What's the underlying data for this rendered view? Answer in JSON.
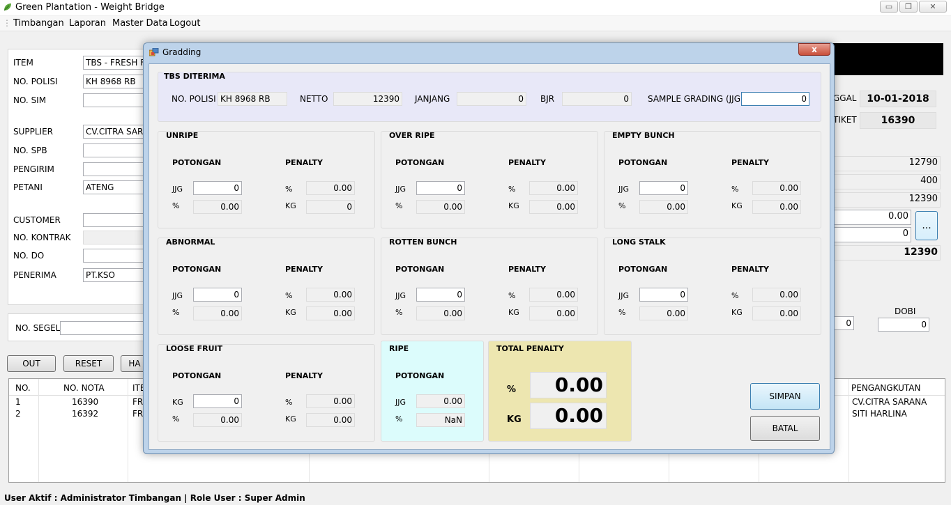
{
  "app": {
    "title": "Green Plantation - Weight Bridge",
    "window_controls": {
      "minimize": "▭",
      "maximize": "❐",
      "close": "✕"
    }
  },
  "menu": [
    "Timbangan",
    "Laporan",
    "Master Data",
    "Logout"
  ],
  "form": {
    "item_label": "ITEM",
    "item_value": "TBS - FRESH FR",
    "no_polisi_label": "NO. POLISI",
    "no_polisi_value": "KH 8968 RB",
    "no_sim_label": "NO. SIM",
    "no_sim_value": "",
    "supplier_label": "SUPPLIER",
    "supplier_value": "CV.CITRA SARA",
    "no_spb_label": "NO. SPB",
    "no_spb_value": "",
    "pengirim_label": "PENGIRIM",
    "pengirim_value": "",
    "petani_label": "PETANI",
    "petani_value": "ATENG",
    "customer_label": "CUSTOMER",
    "customer_value": "",
    "no_kontrak_label": "NO. KONTRAK",
    "no_kontrak_value": "",
    "no_do_label": "NO. DO",
    "no_do_value": "",
    "penerima_label": "PENERIMA",
    "penerima_value": "PT.KSO",
    "no_segel_label": "NO. SEGEL",
    "no_segel_value": ""
  },
  "right_panel": {
    "tanggal_label": "GGAL",
    "tanggal_value": "10-01-2018",
    "tiket_label": "TIKET",
    "tiket_value": "16390",
    "w1": "12790",
    "w2": "400",
    "w3": "12390",
    "w4": "0.00",
    "w5": "0",
    "ellipsis": "...",
    "w6": "12390",
    "dobi_label": "DOBI",
    "dobi_value": "0",
    "left_small": "0"
  },
  "actions": {
    "out": "OUT",
    "reset": "RESET",
    "ha": "HA"
  },
  "grid": {
    "columns": [
      "NO.",
      "NO. NOTA",
      "ITE",
      "PENGANGKUTAN"
    ],
    "rows": [
      {
        "no": "1",
        "nota": "16390",
        "item": "FR",
        "pengangkutan": "CV.CITRA SARANA"
      },
      {
        "no": "2",
        "nota": "16392",
        "item": "FR",
        "pengangkutan": "SITI HARLINA"
      }
    ]
  },
  "status": {
    "text": "User Aktif : Administrator Timbangan  |  Role User : Super Admin"
  },
  "dialog": {
    "title": "Gradding",
    "close": "x",
    "tbs": {
      "title": "TBS DITERIMA",
      "no_polisi_label": "NO. POLISI",
      "no_polisi_value": "KH 8968 RB",
      "netto_label": "NETTO",
      "netto_value": "12390",
      "janjang_label": "JANJANG",
      "janjang_value": "0",
      "bjr_label": "BJR",
      "bjr_value": "0",
      "sample_label": "SAMPLE GRADING (JJG)",
      "sample_value": "0"
    },
    "common": {
      "potongan": "POTONGAN",
      "penalty": "PENALTY",
      "jjg": "JJG",
      "pct": "%",
      "kg": "KG"
    },
    "groups": [
      {
        "title": "UNRIPE",
        "jjg": "0",
        "pct": "0.00",
        "pen_pct": "0.00",
        "pen_kg": "0"
      },
      {
        "title": "OVER RIPE",
        "jjg": "0",
        "pct": "0.00",
        "pen_pct": "0.00",
        "pen_kg": "0.00"
      },
      {
        "title": "EMPTY BUNCH",
        "jjg": "0",
        "pct": "0.00",
        "pen_pct": "0.00",
        "pen_kg": "0.00"
      },
      {
        "title": "ABNORMAL",
        "jjg": "0",
        "pct": "0.00",
        "pen_pct": "0.00",
        "pen_kg": "0.00"
      },
      {
        "title": "ROTTEN BUNCH",
        "jjg": "0",
        "pct": "0.00",
        "pen_pct": "0.00",
        "pen_kg": "0.00"
      },
      {
        "title": "LONG STALK",
        "jjg": "0",
        "pct": "0.00",
        "pen_pct": "0.00",
        "pen_kg": "0.00"
      }
    ],
    "loose_fruit": {
      "title": "LOOSE FRUIT",
      "kg": "0",
      "pct": "0.00",
      "pen_pct": "0.00",
      "pen_kg": "0.00"
    },
    "ripe": {
      "title": "RIPE",
      "jjg": "0.00",
      "pct": "NaN"
    },
    "total": {
      "title": "TOTAL PENALTY",
      "pct_label": "%",
      "pct": "0.00",
      "kg_label": "KG",
      "kg": "0.00"
    },
    "simpan": "SIMPAN",
    "batal": "BATAL"
  },
  "colors": {
    "ripe_bg": "#dcfcfc",
    "total_bg": "#ede6b0",
    "tbs_bg": "#e8e8f8"
  }
}
